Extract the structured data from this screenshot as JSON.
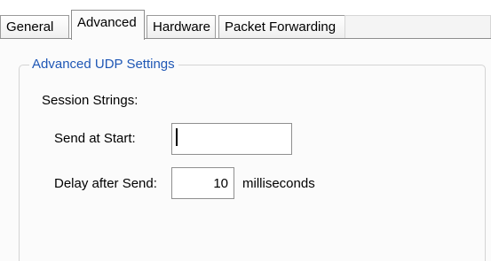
{
  "tabs": [
    {
      "label": "General"
    },
    {
      "label": "Advanced"
    },
    {
      "label": "Hardware"
    },
    {
      "label": "Packet Forwarding"
    }
  ],
  "advanced_udp": {
    "legend": "Advanced UDP Settings",
    "session_strings_label": "Session Strings:",
    "send_at_start_label": "Send at Start:",
    "send_at_start_value": "",
    "delay_after_send_label": "Delay after Send:",
    "delay_after_send_value": "10",
    "delay_units_label": "milliseconds"
  },
  "colors": {
    "legend_text": "#1f57b5",
    "panel_background": "#fbfbfb",
    "border": "#8e8e8e",
    "title_text": "#1a2f8f"
  }
}
